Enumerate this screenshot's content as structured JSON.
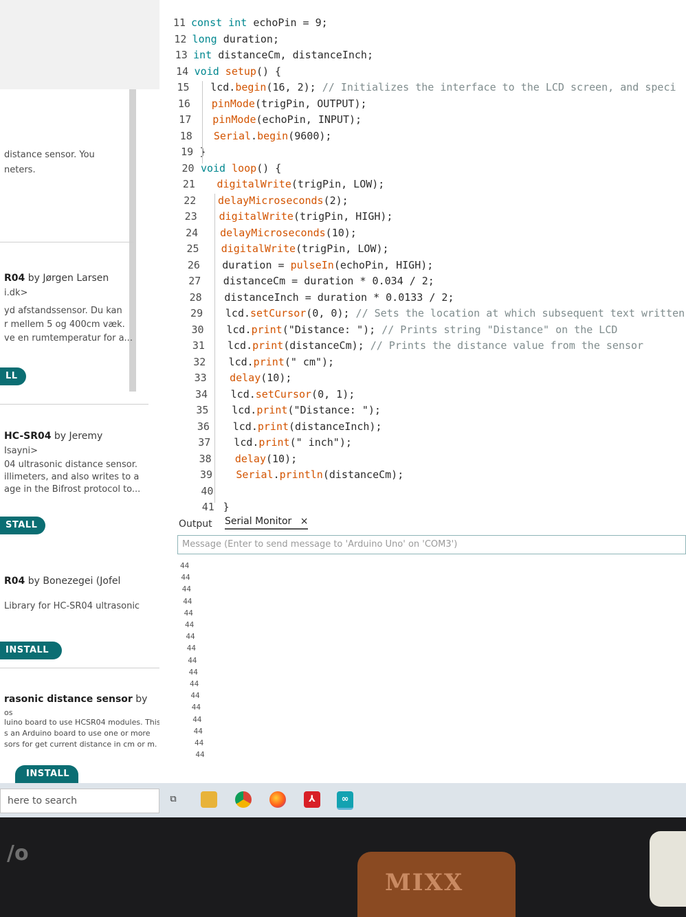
{
  "sidebar": {
    "items": [
      {
        "text1": "distance sensor. You",
        "text2": "neters."
      },
      {
        "title_bold": "R04",
        "title_rest": " by Jørgen Larsen",
        "line2": "i.dk>",
        "desc1": "yd afstandssensor. Du kan",
        "desc2": "r mellem 5 og 400cm væk.",
        "desc3": "ve en rumtemperatur for a...",
        "button": "LL"
      },
      {
        "title_bold": "HC-SR04",
        "title_rest": " by Jeremy",
        "line2": "Isayni>",
        "desc1": "04 ultrasonic distance sensor.",
        "desc2": "illimeters, and also writes to a",
        "desc3": "age in the Bifrost protocol to...",
        "button": "STALL"
      },
      {
        "title_bold": "R04",
        "title_rest": " by Bonezegei (Jofel",
        "desc1": "Library for HC-SR04 ultrasonic",
        "button": "INSTALL"
      },
      {
        "title_bold": "rasonic distance sensor",
        "title_rest": " by",
        "line2": "os",
        "desc1": "luino board to use HCSR04 modules. This",
        "desc2": "s an Arduino board to use one or more",
        "desc3": "sors for get current distance in cm or m.",
        "button": "INSTALL"
      }
    ]
  },
  "editor": {
    "lines": [
      {
        "n": "11",
        "tokens": [
          [
            "kw",
            "const int "
          ],
          [
            "",
            "echoPin = 9;"
          ]
        ]
      },
      {
        "n": "12",
        "tokens": [
          [
            "kw",
            "long "
          ],
          [
            "",
            "duration;"
          ]
        ]
      },
      {
        "n": "13",
        "tokens": [
          [
            "kw",
            "int "
          ],
          [
            "",
            "distanceCm, distanceInch;"
          ]
        ]
      },
      {
        "n": "14",
        "tokens": [
          [
            "kw",
            "void "
          ],
          [
            "fn",
            "setup"
          ],
          [
            "",
            "() {"
          ]
        ]
      },
      {
        "n": "15",
        "tokens": [
          [
            "",
            "lcd."
          ],
          [
            "fn",
            "begin"
          ],
          [
            "",
            "(16, 2); "
          ],
          [
            "cm",
            "// Initializes the interface to the LCD screen, and speci"
          ]
        ]
      },
      {
        "n": "16",
        "tokens": [
          [
            "fn",
            "pinMode"
          ],
          [
            "",
            "(trigPin, OUTPUT);"
          ]
        ]
      },
      {
        "n": "17",
        "tokens": [
          [
            "fn",
            "pinMode"
          ],
          [
            "",
            "(echoPin, INPUT);"
          ]
        ]
      },
      {
        "n": "18",
        "tokens": [
          [
            "fn",
            "Serial"
          ],
          [
            "",
            "."
          ],
          [
            "fn",
            "begin"
          ],
          [
            "",
            "(9600);"
          ]
        ]
      },
      {
        "n": "19",
        "tokens": [
          [
            "",
            "}"
          ]
        ]
      },
      {
        "n": "20",
        "tokens": [
          [
            "kw",
            "void "
          ],
          [
            "fn",
            "loop"
          ],
          [
            "",
            "() {"
          ]
        ]
      },
      {
        "n": "21",
        "tokens": [
          [
            "fn",
            "digitalWrite"
          ],
          [
            "",
            "(trigPin, LOW);"
          ]
        ]
      },
      {
        "n": "22",
        "tokens": [
          [
            "fn",
            "delayMicroseconds"
          ],
          [
            "",
            "(2);"
          ]
        ]
      },
      {
        "n": "23",
        "tokens": [
          [
            "fn",
            "digitalWrite"
          ],
          [
            "",
            "(trigPin, HIGH);"
          ]
        ]
      },
      {
        "n": "24",
        "tokens": [
          [
            "fn",
            "delayMicroseconds"
          ],
          [
            "",
            "(10);"
          ]
        ]
      },
      {
        "n": "25",
        "tokens": [
          [
            "fn",
            "digitalWrite"
          ],
          [
            "",
            "(trigPin, LOW);"
          ]
        ]
      },
      {
        "n": "26",
        "tokens": [
          [
            "",
            "duration = "
          ],
          [
            "fn",
            "pulseIn"
          ],
          [
            "",
            "(echoPin, HIGH);"
          ]
        ]
      },
      {
        "n": "27",
        "tokens": [
          [
            "",
            "distanceCm = duration * 0.034 / 2;"
          ]
        ]
      },
      {
        "n": "28",
        "tokens": [
          [
            "",
            "distanceInch = duration * 0.0133 / 2;"
          ]
        ]
      },
      {
        "n": "29",
        "tokens": [
          [
            "",
            "lcd."
          ],
          [
            "fn",
            "setCursor"
          ],
          [
            "",
            "(0, 0); "
          ],
          [
            "cm",
            "// Sets the location at which subsequent text written to"
          ]
        ]
      },
      {
        "n": "30",
        "tokens": [
          [
            "",
            "lcd."
          ],
          [
            "fn",
            "print"
          ],
          [
            "",
            "(\"Distance: \"); "
          ],
          [
            "cm",
            "// Prints string \"Distance\" on the LCD"
          ]
        ]
      },
      {
        "n": "31",
        "tokens": [
          [
            "",
            "lcd."
          ],
          [
            "fn",
            "print"
          ],
          [
            "",
            "(distanceCm); "
          ],
          [
            "cm",
            "// Prints the distance value from the sensor"
          ]
        ]
      },
      {
        "n": "32",
        "tokens": [
          [
            "",
            "lcd."
          ],
          [
            "fn",
            "print"
          ],
          [
            "",
            "(\" cm\");"
          ]
        ]
      },
      {
        "n": "33",
        "tokens": [
          [
            "fn",
            "delay"
          ],
          [
            "",
            "(10);"
          ]
        ]
      },
      {
        "n": "34",
        "tokens": [
          [
            "",
            "lcd."
          ],
          [
            "fn",
            "setCursor"
          ],
          [
            "",
            "(0, 1);"
          ]
        ]
      },
      {
        "n": "35",
        "tokens": [
          [
            "",
            "lcd."
          ],
          [
            "fn",
            "print"
          ],
          [
            "",
            "(\"Distance: \");"
          ]
        ]
      },
      {
        "n": "36",
        "tokens": [
          [
            "",
            "lcd."
          ],
          [
            "fn",
            "print"
          ],
          [
            "",
            "(distanceInch);"
          ]
        ]
      },
      {
        "n": "37",
        "tokens": [
          [
            "",
            "lcd."
          ],
          [
            "fn",
            "print"
          ],
          [
            "",
            "(\" inch\");"
          ]
        ]
      },
      {
        "n": "38",
        "tokens": [
          [
            "fn",
            "delay"
          ],
          [
            "",
            "(10);"
          ]
        ]
      },
      {
        "n": "39",
        "tokens": [
          [
            "fn",
            "Serial"
          ],
          [
            "",
            "."
          ],
          [
            "fn",
            "println"
          ],
          [
            "",
            "(distanceCm);"
          ]
        ]
      },
      {
        "n": "40",
        "tokens": []
      },
      {
        "n": "41",
        "tokens": [
          [
            "",
            "}"
          ]
        ]
      }
    ]
  },
  "panel": {
    "tab_output": "Output",
    "tab_serial": "Serial Monitor",
    "tab_close": "×",
    "message_placeholder": "Message (Enter to send message to 'Arduino Uno' on 'COM3')",
    "serial_lines": [
      "44",
      "44",
      "44",
      "44",
      "44",
      "44",
      "44",
      "44",
      "44",
      "44",
      "44",
      "44",
      "44",
      "44",
      "44",
      "44",
      "44"
    ]
  },
  "taskbar": {
    "search_text": "here to search",
    "icons": [
      "task-view-icon",
      "file-explorer-icon",
      "chrome-icon",
      "firefox-icon",
      "acrobat-icon",
      "arduino-icon"
    ]
  },
  "physical": {
    "bezel_logo": "/o",
    "desk_text": "MIXX"
  },
  "colors": {
    "keyword": "#00878f",
    "function": "#d35400",
    "comment": "#7f8c8d",
    "install_button": "#0b6e73"
  }
}
